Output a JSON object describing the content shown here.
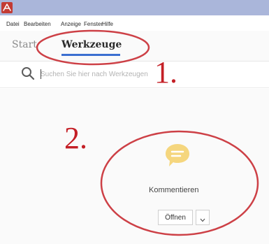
{
  "menubar": {
    "items": [
      "Datei",
      "Bearbeiten",
      "Anzeige",
      "Fenster",
      "Hilfe"
    ]
  },
  "tabs": [
    {
      "label": "Start",
      "active": false
    },
    {
      "label": "Werkzeuge",
      "active": true
    }
  ],
  "search": {
    "placeholder": "Suchen Sie hier nach Werkzeugen"
  },
  "tool": {
    "name": "Kommentieren",
    "open_label": "Öffnen",
    "icon": "speech-bubble-icon"
  },
  "annotations": {
    "marker_1": "1.",
    "marker_2": "2."
  },
  "colors": {
    "titlebar": "#aab6da",
    "app_logo": "#c33b34",
    "tab_underline": "#3b6fd1",
    "comment_icon": "#f5d67e",
    "annotation": "#c41f26"
  }
}
